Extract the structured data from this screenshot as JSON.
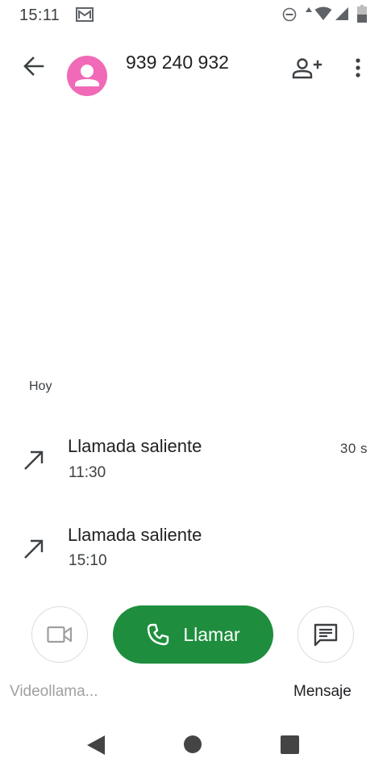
{
  "status_bar": {
    "time": "15:11",
    "icons": [
      "gmail-icon",
      "do-not-disturb-icon",
      "data-arrow-icon",
      "wifi-icon",
      "signal-icon",
      "battery-icon"
    ]
  },
  "header": {
    "contact_number": "939 240 932",
    "avatar_color": "#f06ab7",
    "icons": [
      "back-arrow-icon",
      "avatar-person-icon",
      "add-contact-icon",
      "more-vert-icon"
    ]
  },
  "history": {
    "section_label": "Hoy",
    "calls": [
      {
        "type": "Llamada saliente",
        "time": "11:30",
        "duration": "30 s",
        "icon": "outgoing-call-icon"
      },
      {
        "type": "Llamada saliente",
        "time": "15:10",
        "duration": "",
        "icon": "outgoing-call-icon"
      }
    ]
  },
  "actions": {
    "video_label": "Videollama...",
    "call_label": "Llamar",
    "message_label": "Mensaje",
    "call_button_color": "#1e8e3e"
  },
  "nav_bar": {
    "icons": [
      "nav-back-icon",
      "nav-home-icon",
      "nav-recents-icon"
    ]
  }
}
